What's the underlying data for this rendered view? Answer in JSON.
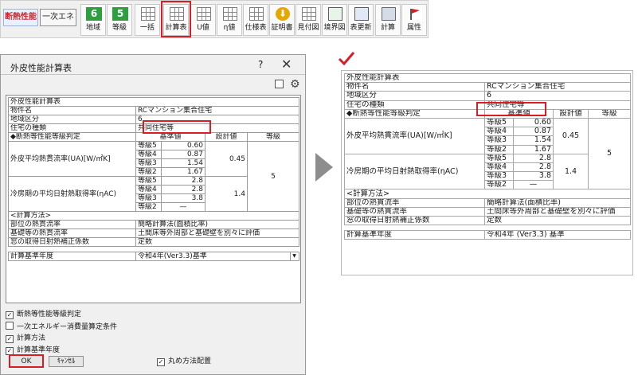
{
  "toolbar": {
    "tag_insulation": "断熱性能",
    "tag_energy": "一次エネ",
    "buttons": [
      {
        "label": "地域",
        "icon_text": "6"
      },
      {
        "label": "等級",
        "icon_text": "5"
      },
      {
        "label": "一括",
        "icon_text": ""
      },
      {
        "label": "計算表",
        "icon_text": ""
      },
      {
        "label": "U値",
        "icon_text": ""
      },
      {
        "label": "η値",
        "icon_text": ""
      },
      {
        "label": "仕様表",
        "icon_text": ""
      },
      {
        "label": "証明書",
        "icon_text": "⬇"
      },
      {
        "label": "見付図",
        "icon_text": ""
      },
      {
        "label": "境界図",
        "icon_text": ""
      },
      {
        "label": "表更新",
        "icon_text": ""
      },
      {
        "label": "計算",
        "icon_text": ""
      },
      {
        "label": "属性",
        "icon_text": ""
      }
    ],
    "accent_color": "#d81e24",
    "level_badge_color": "#2f9e3f"
  },
  "dialog": {
    "title": "外皮性能計算表",
    "help_label": "?",
    "close_label": "✕",
    "gear_icon_text": "⚙",
    "sheet_title": "外皮性能計算表",
    "rows": {
      "property_label": "物件名",
      "property_value": "RCマンション集合住宅",
      "region_label": "地域区分",
      "region_value": "6",
      "type_label": "住宅の種類",
      "type_value": "共同住宅等"
    },
    "grade_header": "◆断熱等性能等級判定",
    "col_standard": "基準値",
    "col_design": "設計値",
    "col_grade": "等級",
    "ua_label": "外皮平均熱貫流率(UA)[W/㎡K]",
    "ua_design": "0.45",
    "ua_grades": [
      {
        "label": "等級5",
        "value": "0.60"
      },
      {
        "label": "等級4",
        "value": "0.87"
      },
      {
        "label": "等級3",
        "value": "1.54"
      },
      {
        "label": "等級2",
        "value": "1.67"
      }
    ],
    "eta_label": "冷房期の平均日射熱取得率(ηAC)",
    "eta_design": "1.4",
    "eta_grades": [
      {
        "label": "等級5",
        "value": "2.8"
      },
      {
        "label": "等級4",
        "value": "2.8"
      },
      {
        "label": "等級3",
        "value": "3.8"
      },
      {
        "label": "等級2",
        "value": "—"
      }
    ],
    "grade_result": "5",
    "method_header": "<計算方法>",
    "methods": [
      {
        "label": "部位の熱貫流率",
        "value": "簡略計算法(面積比率)"
      },
      {
        "label": "基礎等の熱貫流率",
        "value": "土間床等外周部と基礎壁を別々に評価"
      },
      {
        "label": "窓の取得日射熱補正係数",
        "value": "定数"
      }
    ],
    "year_label": "計算基準年度",
    "year_value": "令和4年(Ver3.3)基準",
    "options": [
      {
        "label": "断熱等性能等級判定",
        "checked": "✓"
      },
      {
        "label": "一次エネルギー消費量算定条件",
        "checked": ""
      },
      {
        "label": "計算方法",
        "checked": "✓"
      },
      {
        "label": "計算基準年度",
        "checked": "✓"
      }
    ],
    "rounding_label": "丸め方法配置",
    "rounding_checked": "✓",
    "ok_label": "OK",
    "cancel_label": "ｷｬﾝｾﾙ"
  },
  "result": {
    "title": "外皮性能計算表",
    "property_label": "物件名",
    "property_value": "RCマンション集合住宅",
    "region_label": "地域区分",
    "region_value": "6",
    "type_label": "住宅の種類",
    "type_value": "共同住宅等",
    "grade_header": "◆断熱等性能等級判定",
    "col_standard": "基準値",
    "col_design": "設計値",
    "col_grade": "等級",
    "ua_label": "外皮平均熱貫流率(UA)[W/㎡K]",
    "ua_design": "0.45",
    "ua_grades": [
      {
        "label": "等級5",
        "value": "0.60"
      },
      {
        "label": "等級4",
        "value": "0.87"
      },
      {
        "label": "等級3",
        "value": "1.54"
      },
      {
        "label": "等級2",
        "value": "1.67"
      }
    ],
    "eta_label": "冷房期の平均日射熱取得率(ηAC)",
    "eta_design": "1.4",
    "eta_grades": [
      {
        "label": "等級5",
        "value": "2.8"
      },
      {
        "label": "等級4",
        "value": "2.8"
      },
      {
        "label": "等級3",
        "value": "3.8"
      },
      {
        "label": "等級2",
        "value": "—"
      }
    ],
    "grade_result": "5",
    "method_header": "<計算方法>",
    "methods": [
      {
        "label": "部位の熱貫流率",
        "value": "簡略計算法(面積比率)"
      },
      {
        "label": "基礎等の熱貫流率",
        "value": "土間床等外周部と基礎壁を別々に評価"
      },
      {
        "label": "窓の取得日射熱補正係数",
        "value": "定数"
      }
    ],
    "year_label": "計算基準年度",
    "year_value": "令和4年 (Ver3.3) 基準"
  }
}
